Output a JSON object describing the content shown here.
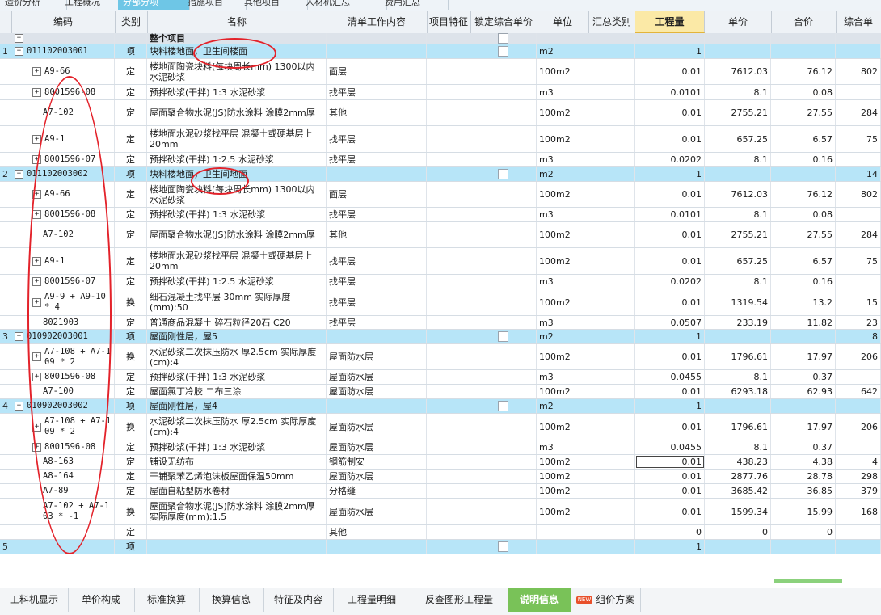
{
  "top_tabs": [
    {
      "label": "造价分析",
      "active": false
    },
    {
      "label": "工程概况",
      "active": false
    },
    {
      "label": "分部分项",
      "active": true
    },
    {
      "label": "措施项目",
      "active": false
    },
    {
      "label": "其他项目",
      "active": false
    },
    {
      "label": "人材机汇总",
      "active": false
    },
    {
      "label": "费用汇总",
      "active": false
    }
  ],
  "columns": [
    "编码",
    "类别",
    "名称",
    "清单工作内容",
    "项目特征",
    "锁定综合单价",
    "单位",
    "汇总类别",
    "工程量",
    "单价",
    "合价",
    "综合单"
  ],
  "highlight_column": "工程量",
  "rows": [
    {
      "num": "",
      "tree": "−",
      "code": "",
      "type": "",
      "name": "整个项目",
      "work": "",
      "unit": "",
      "qty": "",
      "price": "",
      "total": "",
      "comp": "",
      "style": "gray",
      "bold": true,
      "check": true
    },
    {
      "num": "1",
      "tree": "−",
      "code": "011102003001",
      "type": "项",
      "name": "块料楼地面，卫生间楼面",
      "work": "",
      "unit": "m2",
      "qty": "1",
      "price": "",
      "total": "",
      "comp": "",
      "style": "blue",
      "check": true
    },
    {
      "num": "",
      "tree": "+",
      "code": "A9-66",
      "type": "定",
      "name": "楼地面陶瓷块料(每块周长mm) 1300以内 水泥砂浆",
      "work": "面层",
      "unit": "100m2",
      "qty": "0.01",
      "price": "7612.03",
      "total": "76.12",
      "comp": "802"
    },
    {
      "num": "",
      "tree": "+",
      "code": "8001596-08",
      "type": "定",
      "name": "预拌砂浆(干拌) 1:3 水泥砂浆",
      "work": "找平层",
      "unit": "m3",
      "qty": "0.0101",
      "price": "8.1",
      "total": "0.08",
      "comp": ""
    },
    {
      "num": "",
      "tree": "",
      "code": "A7-102",
      "type": "定",
      "name": "屋面聚合物水泥(JS)防水涂料 涂膜2mm厚",
      "work": "其他",
      "unit": "100m2",
      "qty": "0.01",
      "price": "2755.21",
      "total": "27.55",
      "comp": "284"
    },
    {
      "num": "",
      "tree": "+",
      "code": "A9-1",
      "type": "定",
      "name": "楼地面水泥砂浆找平层 混凝土或硬基层上 20mm",
      "work": "找平层",
      "unit": "100m2",
      "qty": "0.01",
      "price": "657.25",
      "total": "6.57",
      "comp": "75"
    },
    {
      "num": "",
      "tree": "+",
      "code": "8001596-07",
      "type": "定",
      "name": "预拌砂浆(干拌) 1:2.5 水泥砂浆",
      "work": "找平层",
      "unit": "m3",
      "qty": "0.0202",
      "price": "8.1",
      "total": "0.16",
      "comp": ""
    },
    {
      "num": "2",
      "tree": "−",
      "code": "011102003002",
      "type": "项",
      "name": "块料楼地面，卫生间地面",
      "work": "",
      "unit": "m2",
      "qty": "1",
      "price": "",
      "total": "",
      "comp": "14",
      "style": "blue",
      "check": true
    },
    {
      "num": "",
      "tree": "+",
      "code": "A9-66",
      "type": "定",
      "name": "楼地面陶瓷块料(每块周长mm) 1300以内 水泥砂浆",
      "work": "面层",
      "unit": "100m2",
      "qty": "0.01",
      "price": "7612.03",
      "total": "76.12",
      "comp": "802"
    },
    {
      "num": "",
      "tree": "+",
      "code": "8001596-08",
      "type": "定",
      "name": "预拌砂浆(干拌) 1:3 水泥砂浆",
      "work": "找平层",
      "unit": "m3",
      "qty": "0.0101",
      "price": "8.1",
      "total": "0.08",
      "comp": ""
    },
    {
      "num": "",
      "tree": "",
      "code": "A7-102",
      "type": "定",
      "name": "屋面聚合物水泥(JS)防水涂料 涂膜2mm厚",
      "work": "其他",
      "unit": "100m2",
      "qty": "0.01",
      "price": "2755.21",
      "total": "27.55",
      "comp": "284"
    },
    {
      "num": "",
      "tree": "+",
      "code": "A9-1",
      "type": "定",
      "name": "楼地面水泥砂浆找平层 混凝土或硬基层上 20mm",
      "work": "找平层",
      "unit": "100m2",
      "qty": "0.01",
      "price": "657.25",
      "total": "6.57",
      "comp": "75"
    },
    {
      "num": "",
      "tree": "+",
      "code": "8001596-07",
      "type": "定",
      "name": "预拌砂浆(干拌) 1:2.5 水泥砂浆",
      "work": "找平层",
      "unit": "m3",
      "qty": "0.0202",
      "price": "8.1",
      "total": "0.16",
      "comp": ""
    },
    {
      "num": "",
      "tree": "+",
      "code": "A9-9 + A9-10 * 4",
      "type": "换",
      "name": "细石混凝土找平层 30mm 实际厚度(mm):50",
      "work": "找平层",
      "unit": "100m2",
      "qty": "0.01",
      "price": "1319.54",
      "total": "13.2",
      "comp": "15"
    },
    {
      "num": "",
      "tree": "",
      "code": "8021903",
      "type": "定",
      "name": "普通商品混凝土 碎石粒径20石 C20",
      "work": "找平层",
      "unit": "m3",
      "qty": "0.0507",
      "price": "233.19",
      "total": "11.82",
      "comp": "23"
    },
    {
      "num": "3",
      "tree": "−",
      "code": "010902003001",
      "type": "项",
      "name": "屋面刚性层，屋5",
      "work": "",
      "unit": "m2",
      "qty": "1",
      "price": "",
      "total": "",
      "comp": "8",
      "style": "blue",
      "check": true
    },
    {
      "num": "",
      "tree": "+",
      "code": "A7-108 + A7-109 * 2",
      "type": "换",
      "name": "水泥砂浆二次抹压防水 厚2.5cm 实际厚度(cm):4",
      "work": "屋面防水层",
      "unit": "100m2",
      "qty": "0.01",
      "price": "1796.61",
      "total": "17.97",
      "comp": "206"
    },
    {
      "num": "",
      "tree": "+",
      "code": "8001596-08",
      "type": "定",
      "name": "预拌砂浆(干拌) 1:3 水泥砂浆",
      "work": "屋面防水层",
      "unit": "m3",
      "qty": "0.0455",
      "price": "8.1",
      "total": "0.37",
      "comp": ""
    },
    {
      "num": "",
      "tree": "",
      "code": "A7-100",
      "type": "定",
      "name": "屋面氯丁冷胶 二布三涂",
      "work": "屋面防水层",
      "unit": "100m2",
      "qty": "0.01",
      "price": "6293.18",
      "total": "62.93",
      "comp": "642"
    },
    {
      "num": "4",
      "tree": "−",
      "code": "010902003002",
      "type": "项",
      "name": "屋面刚性层，屋4",
      "work": "",
      "unit": "m2",
      "qty": "1",
      "price": "",
      "total": "",
      "comp": "",
      "style": "blue",
      "check": true
    },
    {
      "num": "",
      "tree": "+",
      "code": "A7-108 + A7-109 * 2",
      "type": "换",
      "name": "水泥砂浆二次抹压防水 厚2.5cm 实际厚度(cm):4",
      "work": "屋面防水层",
      "unit": "100m2",
      "qty": "0.01",
      "price": "1796.61",
      "total": "17.97",
      "comp": "206"
    },
    {
      "num": "",
      "tree": "+",
      "code": "8001596-08",
      "type": "定",
      "name": "预拌砂浆(干拌) 1:3 水泥砂浆",
      "work": "屋面防水层",
      "unit": "m3",
      "qty": "0.0455",
      "price": "8.1",
      "total": "0.37",
      "comp": ""
    },
    {
      "num": "",
      "tree": "",
      "code": "A8-163",
      "type": "定",
      "name": "铺设无纺布",
      "work": "钢筋制安",
      "unit": "100m2",
      "qty": "0.01",
      "price": "438.23",
      "total": "4.38",
      "comp": "4",
      "selected": true
    },
    {
      "num": "",
      "tree": "",
      "code": "A8-164",
      "type": "定",
      "name": "干铺聚苯乙烯泡沫板屋面保温50mm",
      "work": "屋面防水层",
      "unit": "100m2",
      "qty": "0.01",
      "price": "2877.76",
      "total": "28.78",
      "comp": "298"
    },
    {
      "num": "",
      "tree": "",
      "code": "A7-89",
      "type": "定",
      "name": "屋面自粘型防水卷材",
      "work": "分格缝",
      "unit": "100m2",
      "qty": "0.01",
      "price": "3685.42",
      "total": "36.85",
      "comp": "379"
    },
    {
      "num": "",
      "tree": "",
      "code": "A7-102 + A7-103 * -1",
      "type": "换",
      "name": "屋面聚合物水泥(JS)防水涂料 涂膜2mm厚 实际厚度(mm):1.5",
      "work": "屋面防水层",
      "unit": "100m2",
      "qty": "0.01",
      "price": "1599.34",
      "total": "15.99",
      "comp": "168"
    },
    {
      "num": "",
      "tree": "",
      "code": "",
      "type": "定",
      "name": "",
      "work": "其他",
      "unit": "",
      "qty": "0",
      "price": "0",
      "total": "0",
      "comp": ""
    },
    {
      "num": "5",
      "tree": "",
      "code": "",
      "type": "项",
      "name": "",
      "work": "",
      "unit": "",
      "qty": "1",
      "price": "",
      "total": "",
      "comp": "",
      "style": "blue",
      "check": true
    }
  ],
  "bottom_tabs": [
    {
      "label": "工料机显示",
      "active": false
    },
    {
      "label": "单价构成",
      "active": false
    },
    {
      "label": "标准换算",
      "active": false
    },
    {
      "label": "换算信息",
      "active": false
    },
    {
      "label": "特征及内容",
      "active": false
    },
    {
      "label": "工程量明细",
      "active": false
    },
    {
      "label": "反查图形工程量",
      "active": false
    },
    {
      "label": "说明信息",
      "active": true
    },
    {
      "label": "组价方案",
      "active": false,
      "badge": "NEW"
    }
  ],
  "colors": {
    "accent_blue": "#b7e5f8",
    "active_tab_green": "#79c258",
    "annotation_red": "#e3222a",
    "highlight_header": "#fbe9a6"
  }
}
